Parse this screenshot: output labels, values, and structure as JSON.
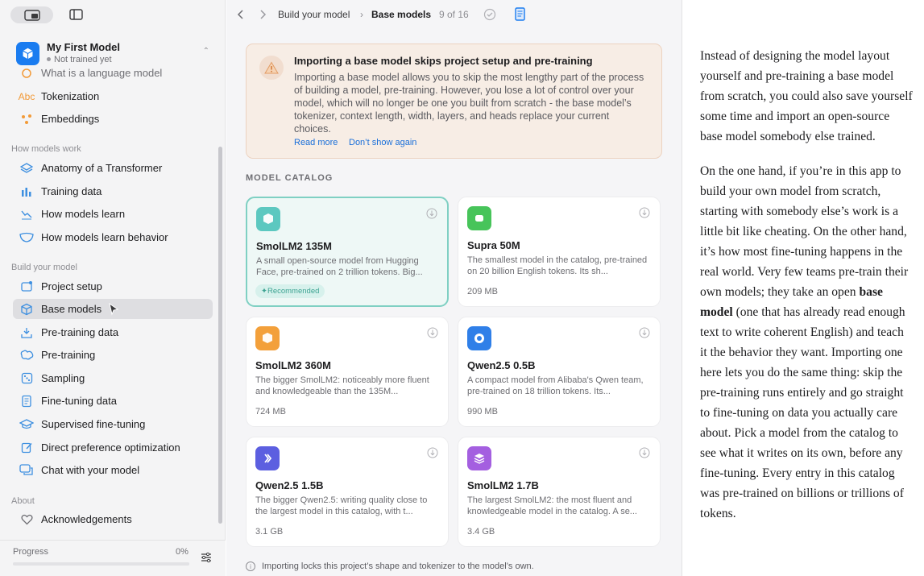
{
  "colors": {
    "accent": "#1a7cf0",
    "selected_card": "#7fd0c3",
    "warning_bg": "#f7ede5",
    "link": "#1a6fd9"
  },
  "model": {
    "name": "My First Model",
    "status": "Not trained yet"
  },
  "sidebar": {
    "partial_item": "What is a language model",
    "top_items": [
      {
        "label": "Tokenization",
        "icon": "abc-icon"
      },
      {
        "label": "Embeddings",
        "icon": "dots-icon"
      }
    ],
    "sections": [
      {
        "title": "How models work",
        "items": [
          {
            "label": "Anatomy of a Transformer",
            "icon": "layers-icon"
          },
          {
            "label": "Training data",
            "icon": "bars-icon"
          },
          {
            "label": "How models learn",
            "icon": "chart-icon"
          },
          {
            "label": "How models learn behavior",
            "icon": "mask-icon"
          }
        ]
      },
      {
        "title": "Build your model",
        "items": [
          {
            "label": "Project setup",
            "icon": "setup-icon"
          },
          {
            "label": "Base models",
            "icon": "cube-icon",
            "active": true
          },
          {
            "label": "Pre-training data",
            "icon": "download-tray-icon"
          },
          {
            "label": "Pre-training",
            "icon": "brain-icon"
          },
          {
            "label": "Sampling",
            "icon": "dice-icon"
          },
          {
            "label": "Fine-tuning data",
            "icon": "doc-icon"
          },
          {
            "label": "Supervised fine-tuning",
            "icon": "graduation-icon"
          },
          {
            "label": "Direct preference optimization",
            "icon": "pencil-icon"
          },
          {
            "label": "Chat with your model",
            "icon": "chat-icon"
          }
        ]
      },
      {
        "title": "About",
        "items": [
          {
            "label": "Acknowledgements",
            "icon": "heart-icon"
          }
        ]
      }
    ],
    "progress_label": "Progress",
    "progress_value": "0%",
    "progress_fraction": 0
  },
  "toolbar": {
    "crumb_parent": "Build your model",
    "crumb_sep": "›",
    "crumb_current": "Base models",
    "crumb_count": "9 of 16"
  },
  "banner": {
    "title": "Importing a base model skips project setup and pre-training",
    "body": "Importing a base model allows you to skip the most lengthy part of the process of building a model, pre-training. However, you lose a lot of control over your model, which will no longer be one you built from scratch - the base model’s tokenizer, context length, width, layers, and heads replace your current choices.",
    "read_more": "Read more",
    "dont_show": "Don’t show again"
  },
  "catalog": {
    "title": "MODEL CATALOG",
    "cards": [
      {
        "name": "SmolLM2 135M",
        "desc": "A small open-source model from Hugging Face, pre-trained on 2 trillion tokens. Big...",
        "badge": "Recommended",
        "color": "#5cc8c0",
        "selected": true
      },
      {
        "name": "Supra 50M",
        "desc": "The smallest model in the catalog, pre-trained on 20 billion English tokens. Its sh...",
        "size": "209 MB",
        "color": "#47c45a"
      },
      {
        "name": "SmolLM2 360M",
        "desc": "The bigger SmolLM2: noticeably more fluent and knowledgeable than the 135M...",
        "size": "724 MB",
        "color": "#f3a03b"
      },
      {
        "name": "Qwen2.5 0.5B",
        "desc": "A compact model from Alibaba's Qwen team, pre-trained on 18 trillion tokens. Its...",
        "size": "990 MB",
        "color": "#2f7fe8"
      },
      {
        "name": "Qwen2.5 1.5B",
        "desc": "The bigger Qwen2.5: writing quality close to the largest model in this catalog, with t...",
        "size": "3.1 GB",
        "color": "#5c5fe0"
      },
      {
        "name": "SmolLM2 1.7B",
        "desc": "The largest SmolLM2: the most fluent and knowledgeable model in the catalog. A se...",
        "size": "3.4 GB",
        "color": "#a45fe0"
      }
    ],
    "footnote": "Importing locks this project’s shape and tokenizer to the model’s own."
  },
  "reader": {
    "p1": "Instead of designing the model layout yourself and pre-training a base model from scratch, you could also save yourself some time and import an open-source base model somebody else trained.",
    "p2_a": "On the one hand, if you’re in this app to build your own model from scratch, starting with somebody else’s work is a little bit like cheating. On the other hand, it’s how most fine-tuning happens in the real world. Very few teams pre-train their own models; they take an open ",
    "p2_bold": "base model",
    "p2_b": " (one that has already read enough text to write coherent English) and teach it the behavior they want. Importing one here lets you do the same thing: skip the pre-training runs entirely and go straight to fine-tuning on data you actually care about. Pick a model from the catalog to see what it writes on its own, before any fine-tuning. Every entry in this catalog was pre-trained on billions or trillions of tokens."
  }
}
